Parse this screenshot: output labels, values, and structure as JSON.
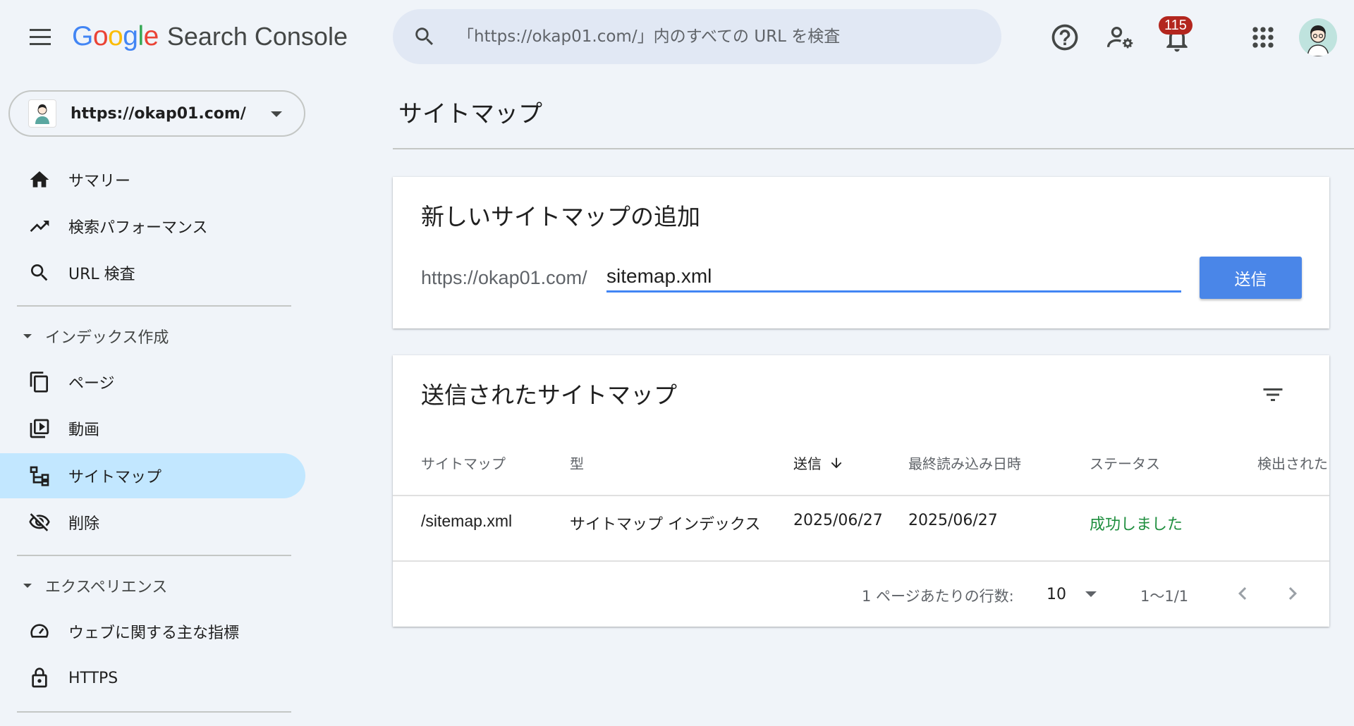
{
  "header": {
    "logo_letters": [
      "G",
      "o",
      "o",
      "g",
      "l",
      "e"
    ],
    "logo_colors": [
      "#4285f4",
      "#ea4335",
      "#fbbc05",
      "#4285f4",
      "#34a853",
      "#ea4335"
    ],
    "product_name": "Search Console",
    "search_placeholder": "「https://okap01.com/」内のすべての URL を検査",
    "notification_count": "115"
  },
  "sidebar": {
    "property_url": "https://okap01.com/",
    "items": [
      {
        "label": "サマリー",
        "icon": "home-icon"
      },
      {
        "label": "検索パフォーマンス",
        "icon": "trending-up-icon"
      },
      {
        "label": "URL 検査",
        "icon": "search-icon"
      }
    ],
    "section_index": {
      "label": "インデックス作成",
      "items": [
        {
          "label": "ページ",
          "icon": "pages-icon"
        },
        {
          "label": "動画",
          "icon": "video-icon"
        },
        {
          "label": "サイトマップ",
          "icon": "sitemap-icon",
          "active": true
        },
        {
          "label": "削除",
          "icon": "visibility-off-icon"
        }
      ]
    },
    "section_experience": {
      "label": "エクスペリエンス",
      "items": [
        {
          "label": "ウェブに関する主な指標",
          "icon": "speed-icon"
        },
        {
          "label": "HTTPS",
          "icon": "lock-icon"
        }
      ]
    }
  },
  "main": {
    "page_title": "サイトマップ",
    "add_card": {
      "title": "新しいサイトマップの追加",
      "url_prefix": "https://okap01.com/",
      "input_value": "sitemap.xml",
      "submit_label": "送信"
    },
    "list_card": {
      "title": "送信されたサイトマップ",
      "columns": [
        "サイトマップ",
        "型",
        "送信",
        "最終読み込み日時",
        "ステータス",
        "検出された"
      ],
      "rows": [
        {
          "sitemap": "/sitemap.xml",
          "type": "サイトマップ インデックス",
          "submitted": "2025/06/27",
          "last_read": "2025/06/27",
          "status": "成功しました"
        }
      ],
      "rows_per_page_label": "1 ページあたりの行数:",
      "rows_per_page": "10",
      "range": "1〜1/1"
    }
  },
  "colors": {
    "accent": "#4a86e8",
    "active_nav": "#c2e7ff",
    "success": "#1e8e3e",
    "badge": "#b3261e"
  }
}
